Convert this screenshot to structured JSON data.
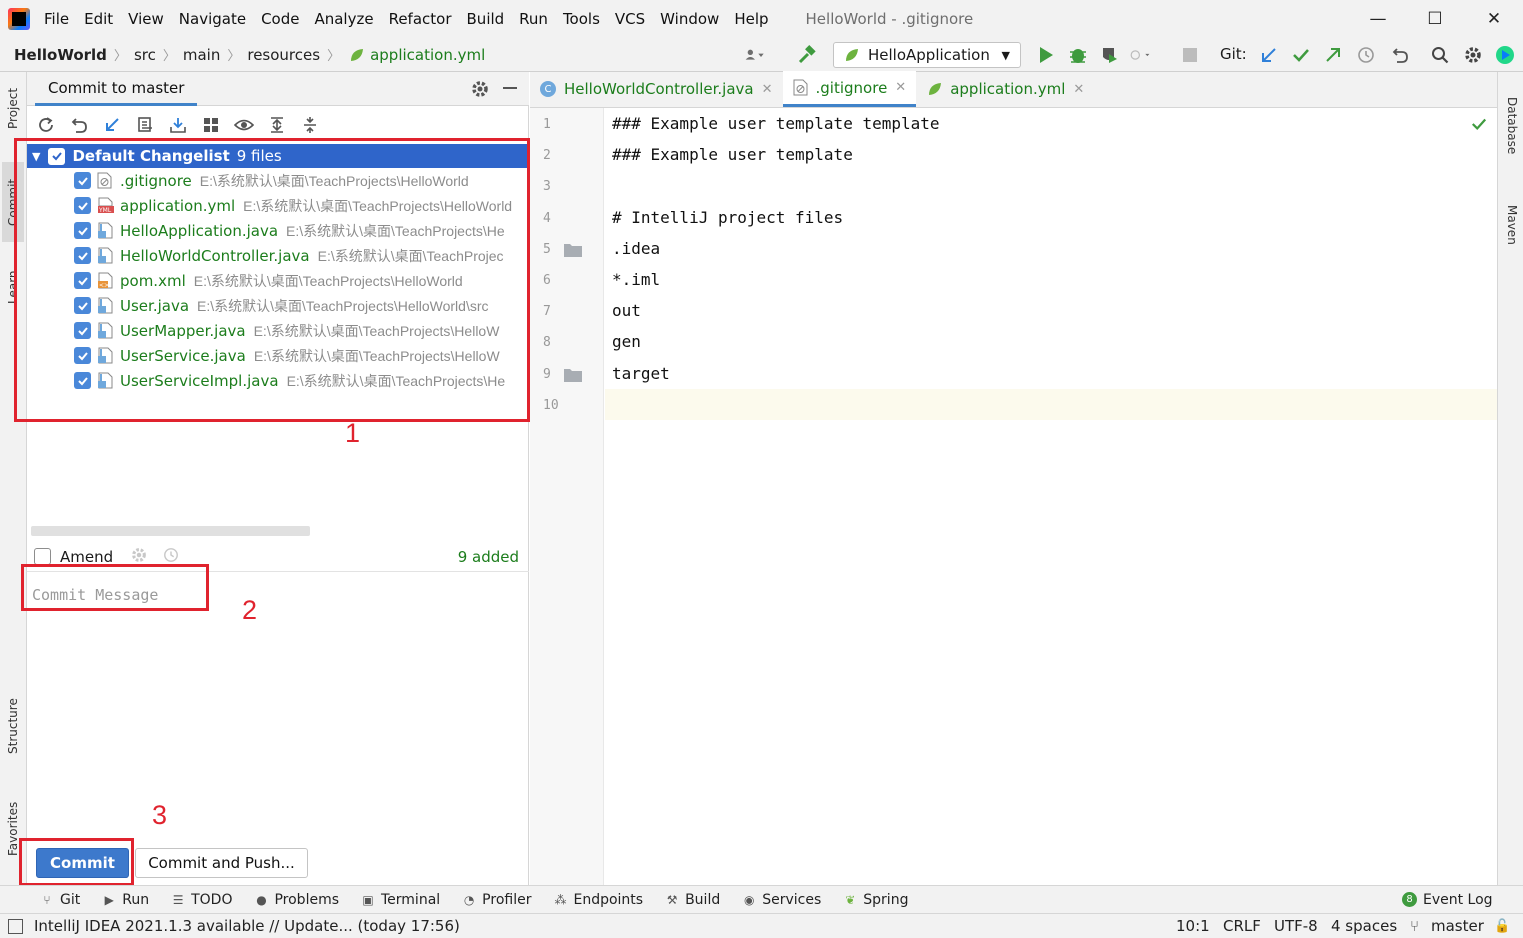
{
  "menubar": {
    "items": [
      "File",
      "Edit",
      "View",
      "Navigate",
      "Code",
      "Analyze",
      "Refactor",
      "Build",
      "Run",
      "Tools",
      "VCS",
      "Window",
      "Help"
    ],
    "window_title": "HelloWorld - .gitignore",
    "controls": [
      "—",
      "☐",
      "✕"
    ]
  },
  "navbar": {
    "breadcrumbs": [
      "HelloWorld",
      "src",
      "main",
      "resources",
      "application.yml"
    ],
    "run_config": "HelloApplication",
    "git_label": "Git:"
  },
  "left_stripe": [
    "Project",
    "Commit",
    "Learn",
    "Structure",
    "Favorites"
  ],
  "right_stripe": [
    "Database",
    "Maven"
  ],
  "commit_panel": {
    "tab_title": "Commit to master",
    "changelist": {
      "name": "Default Changelist",
      "count": "9 files"
    },
    "files": [
      {
        "name": ".gitignore",
        "path": "E:\\系统默认\\桌面\\TeachProjects\\HelloWorld",
        "icon": "gitignore-file-icon"
      },
      {
        "name": "application.yml",
        "path": "E:\\系统默认\\桌面\\TeachProjects\\HelloWorld",
        "icon": "yaml-file-icon"
      },
      {
        "name": "HelloApplication.java",
        "path": "E:\\系统默认\\桌面\\TeachProjects\\He",
        "icon": "java-file-icon"
      },
      {
        "name": "HelloWorldController.java",
        "path": "E:\\系统默认\\桌面\\TeachProjec",
        "icon": "java-file-icon"
      },
      {
        "name": "pom.xml",
        "path": "E:\\系统默认\\桌面\\TeachProjects\\HelloWorld",
        "icon": "xml-file-icon"
      },
      {
        "name": "User.java",
        "path": "E:\\系统默认\\桌面\\TeachProjects\\HelloWorld\\src",
        "icon": "java-file-icon"
      },
      {
        "name": "UserMapper.java",
        "path": "E:\\系统默认\\桌面\\TeachProjects\\HelloW",
        "icon": "java-file-icon"
      },
      {
        "name": "UserService.java",
        "path": "E:\\系统默认\\桌面\\TeachProjects\\HelloW",
        "icon": "java-file-icon"
      },
      {
        "name": "UserServiceImpl.java",
        "path": "E:\\系统默认\\桌面\\TeachProjects\\He",
        "icon": "java-file-icon"
      }
    ],
    "amend_label": "Amend",
    "added_count": "9 added",
    "commit_message_placeholder": "Commit Message",
    "commit_button": "Commit",
    "commit_push_button": "Commit and Push..."
  },
  "annotations": {
    "label_1": "1",
    "label_2": "2",
    "label_3": "3",
    "color": "#e0232e"
  },
  "editor": {
    "tabs": [
      {
        "label": "HelloWorldController.java",
        "active": false
      },
      {
        "label": ".gitignore",
        "active": true
      },
      {
        "label": "application.yml",
        "active": false
      }
    ],
    "lines": [
      "### Example user template template",
      "### Example user template",
      "",
      "# IntelliJ project files",
      ".idea",
      "*.iml",
      "out",
      "gen",
      "target",
      ""
    ],
    "line_numbers": [
      "1",
      "2",
      "3",
      "4",
      "5",
      "6",
      "7",
      "8",
      "9",
      "10"
    ]
  },
  "toolwindows": [
    "Git",
    "Run",
    "TODO",
    "Problems",
    "Terminal",
    "Profiler",
    "Endpoints",
    "Build",
    "Services",
    "Spring"
  ],
  "event_log": {
    "badge": "8",
    "label": "Event Log"
  },
  "statusbar": {
    "message": "IntelliJ IDEA 2021.1.3 available // Update... (today 17:56)",
    "position": "10:1",
    "line_sep": "CRLF",
    "encoding": "UTF-8",
    "indent": "4 spaces",
    "branch": "master"
  },
  "colors": {
    "accent": "#2f65ca",
    "added_file": "#1c7d1c",
    "commit_button": "#3d79cc"
  }
}
